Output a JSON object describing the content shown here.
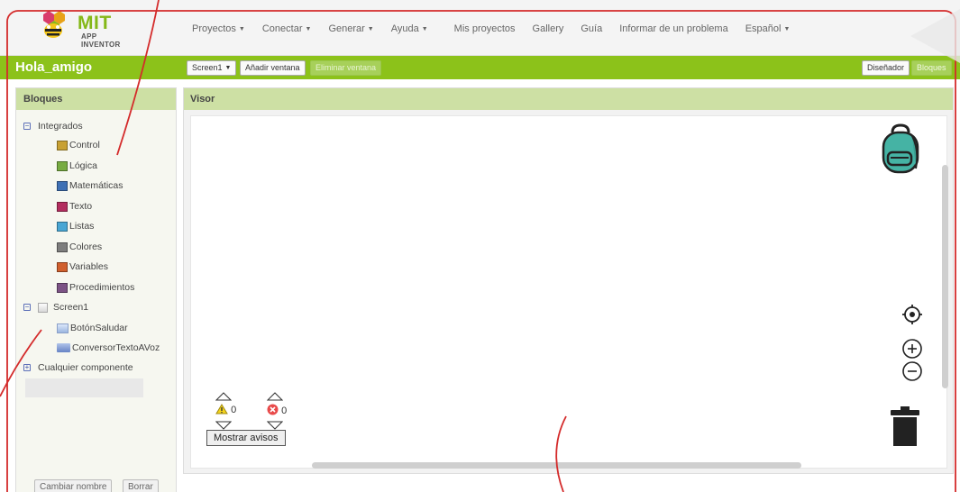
{
  "brand": {
    "name": "MIT",
    "subtitle": "APP INVENTOR"
  },
  "nav": {
    "items": [
      {
        "label": "Proyectos",
        "dropdown": true
      },
      {
        "label": "Conectar",
        "dropdown": true
      },
      {
        "label": "Generar",
        "dropdown": true
      },
      {
        "label": "Ayuda",
        "dropdown": true
      },
      {
        "label": "Mis proyectos",
        "dropdown": false
      },
      {
        "label": "Gallery",
        "dropdown": false
      },
      {
        "label": "Guía",
        "dropdown": false
      },
      {
        "label": "Informar de un problema",
        "dropdown": false
      },
      {
        "label": "Español",
        "dropdown": true
      }
    ]
  },
  "toolbar": {
    "project_name": "Hola_amigo",
    "screen_select": "Screen1",
    "add_screen": "Añadir ventana",
    "remove_screen": "Eliminar ventana",
    "designer": "Diseñador",
    "blocks": "Bloques"
  },
  "blocks_panel": {
    "title": "Bloques",
    "builtin_label": "Integrados",
    "builtin": [
      {
        "label": "Control",
        "color": "#c8a133"
      },
      {
        "label": "Lógica",
        "color": "#77ab41"
      },
      {
        "label": "Matemáticas",
        "color": "#3f71b5"
      },
      {
        "label": "Texto",
        "color": "#b32d5e"
      },
      {
        "label": "Listas",
        "color": "#49a6d4"
      },
      {
        "label": "Colores",
        "color": "#7d7d7d"
      },
      {
        "label": "Variables",
        "color": "#d05f2d"
      },
      {
        "label": "Procedimientos",
        "color": "#7c5385"
      }
    ],
    "screen_label": "Screen1",
    "components": [
      "BotónSaludar",
      "ConversorTextoAVoz"
    ],
    "any_component": "Cualquier componente",
    "rename_button": "Cambiar nombre",
    "delete_button": "Borrar"
  },
  "viewer": {
    "title": "Visor",
    "warnings": "0",
    "errors": "0",
    "show_warnings": "Mostrar avisos"
  }
}
